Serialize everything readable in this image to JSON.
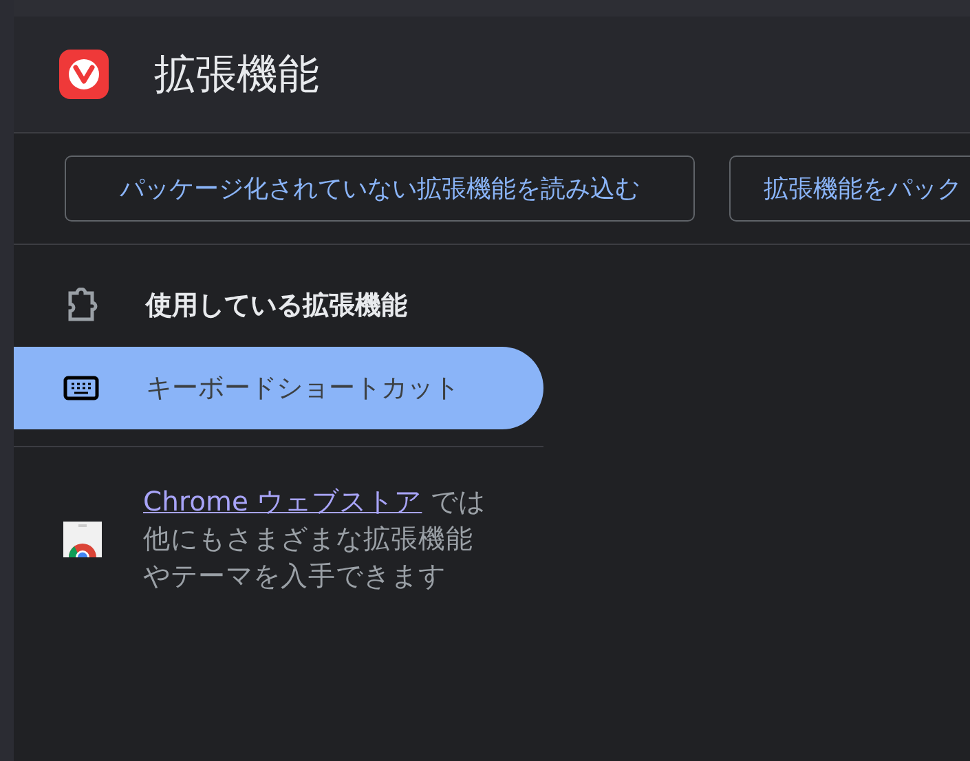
{
  "header": {
    "title": "拡張機能"
  },
  "toolbar": {
    "buttons": [
      "パッケージ化されていない拡張機能を読み込む",
      "拡張機能をパック"
    ]
  },
  "sidebar": {
    "items": [
      {
        "label": "使用している拡張機能",
        "kind": "extensions",
        "selected": false
      },
      {
        "label": "キーボードショートカット",
        "kind": "keyboard",
        "selected": true
      }
    ]
  },
  "store_promo": {
    "link": "Chrome ウェブストア",
    "text": " では他にもさまざまな拡張機能やテーマを入手できます"
  }
}
